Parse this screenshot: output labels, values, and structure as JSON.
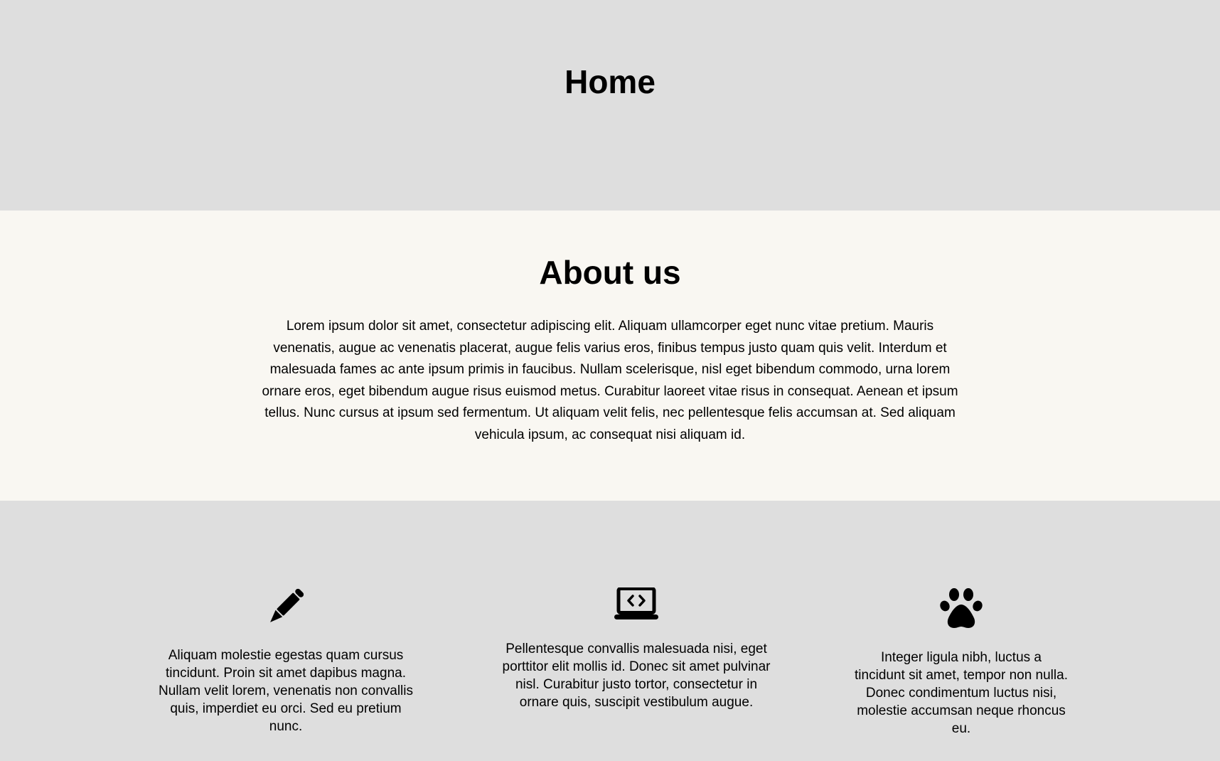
{
  "hero": {
    "title": "Home"
  },
  "about": {
    "title": "About us",
    "body": "Lorem ipsum dolor sit amet, consectetur adipiscing elit. Aliquam ullamcorper eget nunc vitae pretium. Mauris venenatis, augue ac venenatis placerat, augue felis varius eros, finibus tempus justo quam quis velit. Interdum et malesuada fames ac ante ipsum primis in faucibus. Nullam scelerisque, nisl eget bibendum commodo, urna lorem ornare eros, eget bibendum augue risus euismod metus. Curabitur laoreet vitae risus in consequat. Aenean et ipsum tellus. Nunc cursus at ipsum sed fermentum. Ut aliquam velit felis, nec pellentesque felis accumsan at. Sed aliquam vehicula ipsum, ac consequat nisi aliquam id."
  },
  "features": [
    {
      "icon": "pencil-icon",
      "text": "Aliquam molestie egestas quam cursus tincidunt. Proin sit amet dapibus magna. Nullam velit lorem, venenatis non convallis quis, imperdiet eu orci. Sed eu pretium nunc."
    },
    {
      "icon": "laptop-code-icon",
      "text": "Pellentesque convallis malesuada nisi, eget porttitor elit mollis id. Donec sit amet pulvinar nisl. Curabitur justo tortor, consectetur in ornare quis, suscipit vestibulum augue."
    },
    {
      "icon": "paw-icon",
      "text": "Integer ligula nibh, luctus a tincidunt sit amet, tempor non nulla. Donec condimentum luctus nisi, molestie accumsan neque rhoncus eu."
    }
  ],
  "colors": {
    "hero_bg": "#dedede",
    "about_bg": "#f9f7f2",
    "features_bg": "#dedede",
    "text": "#000000"
  }
}
